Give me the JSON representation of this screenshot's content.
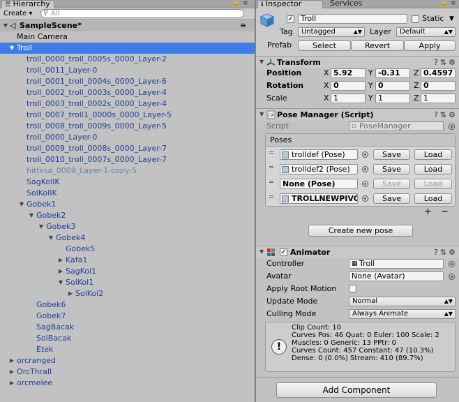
{
  "hierarchy": {
    "tab_label": "Hierarchy",
    "create_label": "Create ▾",
    "search_placeholder": "All",
    "scene_name": "SampleScene*",
    "rows": [
      {
        "label": "Main Camera",
        "indent": 24,
        "arrow": "",
        "style": "normal"
      },
      {
        "label": "Troll",
        "indent": 24,
        "arrow": "down",
        "style": "selected"
      },
      {
        "label": "troll_0000_troll_0005s_0000_Layer-2",
        "indent": 38,
        "arrow": "",
        "style": "blue"
      },
      {
        "label": "troll_0011_Layer-0",
        "indent": 38,
        "arrow": "",
        "style": "blue"
      },
      {
        "label": "troll_0001_troll_0004s_0000_Layer-6",
        "indent": 38,
        "arrow": "",
        "style": "blue"
      },
      {
        "label": "troll_0002_troll_0003s_0000_Layer-4",
        "indent": 38,
        "arrow": "",
        "style": "blue"
      },
      {
        "label": "troll_0003_troll_0002s_0000_Layer-4",
        "indent": 38,
        "arrow": "",
        "style": "blue"
      },
      {
        "label": "troll_0007_troll1_0000s_0000_Layer-5",
        "indent": 38,
        "arrow": "",
        "style": "blue"
      },
      {
        "label": "troll_0008_troll_0009s_0000_Layer-5",
        "indent": 38,
        "arrow": "",
        "style": "blue"
      },
      {
        "label": "troll_0000_Layer-0",
        "indent": 38,
        "arrow": "",
        "style": "blue"
      },
      {
        "label": "troll_0009_troll_0008s_0000_Layer-7",
        "indent": 38,
        "arrow": "",
        "style": "blue"
      },
      {
        "label": "troll_0010_troll_0007s_0000_Layer-7",
        "indent": 38,
        "arrow": "",
        "style": "blue"
      },
      {
        "label": "hitfxsa_0009_Layer-1-copy-5",
        "indent": 38,
        "arrow": "",
        "style": "faded"
      },
      {
        "label": "SagKolIK",
        "indent": 38,
        "arrow": "",
        "style": "blue"
      },
      {
        "label": "SolKolIK",
        "indent": 38,
        "arrow": "",
        "style": "blue"
      },
      {
        "label": "Gobek1",
        "indent": 38,
        "arrow": "down",
        "style": "blue"
      },
      {
        "label": "Gobek2",
        "indent": 52,
        "arrow": "down",
        "style": "blue"
      },
      {
        "label": "Gobek3",
        "indent": 66,
        "arrow": "down",
        "style": "blue"
      },
      {
        "label": "Gobek4",
        "indent": 80,
        "arrow": "down",
        "style": "blue"
      },
      {
        "label": "Gobek5",
        "indent": 94,
        "arrow": "",
        "style": "blue"
      },
      {
        "label": "Kafa1",
        "indent": 94,
        "arrow": "right",
        "style": "blue"
      },
      {
        "label": "SagKol1",
        "indent": 94,
        "arrow": "right",
        "style": "blue"
      },
      {
        "label": "SolKol1",
        "indent": 94,
        "arrow": "down",
        "style": "blue"
      },
      {
        "label": "SolKol2",
        "indent": 108,
        "arrow": "right",
        "style": "blue"
      },
      {
        "label": "Gobek6",
        "indent": 52,
        "arrow": "",
        "style": "blue"
      },
      {
        "label": "Gobek7",
        "indent": 52,
        "arrow": "",
        "style": "blue"
      },
      {
        "label": "SagBacak",
        "indent": 52,
        "arrow": "",
        "style": "blue"
      },
      {
        "label": "SolBacak",
        "indent": 52,
        "arrow": "",
        "style": "blue"
      },
      {
        "label": "Etek",
        "indent": 52,
        "arrow": "",
        "style": "blue"
      },
      {
        "label": "orcranged",
        "indent": 24,
        "arrow": "right",
        "style": "blue"
      },
      {
        "label": "OrcThrall",
        "indent": 24,
        "arrow": "right",
        "style": "blue"
      },
      {
        "label": "orcmelee",
        "indent": 24,
        "arrow": "right",
        "style": "blue"
      }
    ]
  },
  "inspector": {
    "tab_label": "Inspector",
    "services_tab": "Services",
    "object_name": "Troll",
    "static_label": "Static",
    "tag_label": "Tag",
    "tag_value": "Untagged",
    "layer_label": "Layer",
    "layer_value": "Default",
    "prefab_label": "Prefab",
    "prefab_select": "Select",
    "prefab_revert": "Revert",
    "prefab_apply": "Apply",
    "transform": {
      "title": "Transform",
      "position_label": "Position",
      "rotation_label": "Rotation",
      "scale_label": "Scale",
      "position": {
        "x": "5.92",
        "y": "-0.31",
        "z": "0.4597"
      },
      "rotation": {
        "x": "0",
        "y": "0",
        "z": "0"
      },
      "scale": {
        "x": "1",
        "y": "1",
        "z": "1"
      },
      "axis_x": "X",
      "axis_y": "Y",
      "axis_z": "Z"
    },
    "pose_manager": {
      "title": "Pose Manager (Script)",
      "script_label": "Script",
      "script_value": "PoseManager",
      "poses_header": "Poses",
      "poses": [
        {
          "name": "trolldef (Pose)",
          "save": "Save",
          "load": "Load",
          "enabled": true,
          "bold": false
        },
        {
          "name": "trolldef2 (Pose)",
          "save": "Save",
          "load": "Load",
          "enabled": true,
          "bold": false
        },
        {
          "name": "None (Pose)",
          "save": "Save",
          "load": "Load",
          "enabled": false,
          "bold": true
        },
        {
          "name": "TROLLNEWPIVO",
          "save": "Save",
          "load": "Load",
          "enabled": true,
          "bold": true
        }
      ],
      "add_symbol": "+",
      "remove_symbol": "−",
      "create_button": "Create new pose"
    },
    "animator": {
      "title": "Animator",
      "controller_label": "Controller",
      "controller_value": "Troll",
      "avatar_label": "Avatar",
      "avatar_value": "None (Avatar)",
      "apply_root_label": "Apply Root Motion",
      "update_mode_label": "Update Mode",
      "update_mode_value": "Normal",
      "culling_mode_label": "Culling Mode",
      "culling_mode_value": "Always Animate",
      "info_lines": [
        "Clip Count: 10",
        "Curves Pos: 46 Quat: 0 Euler: 100 Scale: 2",
        "Muscles: 0 Generic: 13 PPtr: 0",
        "Curves Count: 457 Constant: 47 (10.3%)",
        "Dense: 0 (0.0%) Stream: 410 (89.7%)"
      ],
      "info_icon": "!"
    },
    "add_component": "Add Component"
  },
  "colors": {
    "selection": "#3e7de7",
    "prefab_text": "#1f3f9a"
  }
}
